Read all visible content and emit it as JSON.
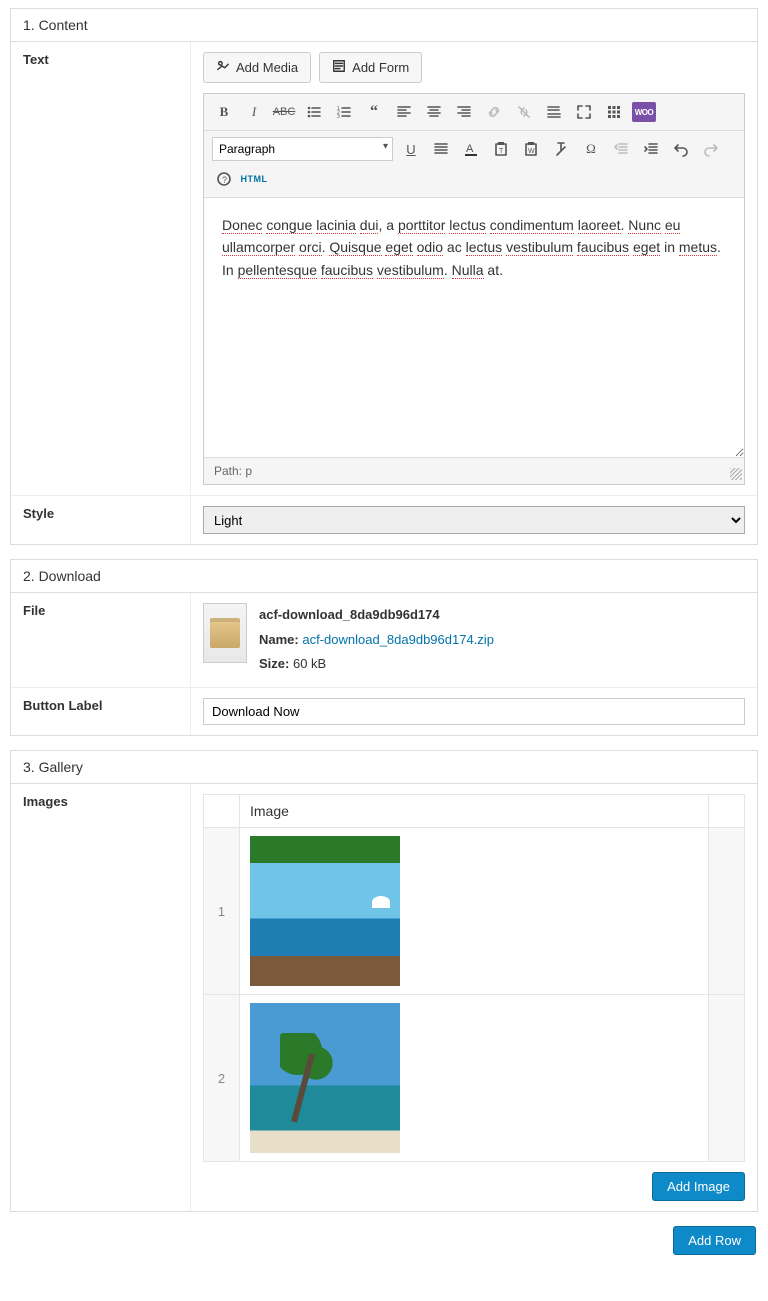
{
  "sections": {
    "content": {
      "title": "1. Content"
    },
    "download": {
      "title": "2. Download"
    },
    "gallery": {
      "title": "3. Gallery"
    }
  },
  "content": {
    "text_label": "Text",
    "add_media": "Add Media",
    "add_form": "Add Form",
    "paragraph_sel": "Paragraph",
    "woo_badge": "WOO",
    "html_badge": "HTML",
    "body_tokens": [
      {
        "t": "Donec",
        "s": 1
      },
      {
        "t": " ",
        "s": 0
      },
      {
        "t": "congue",
        "s": 1
      },
      {
        "t": " ",
        "s": 0
      },
      {
        "t": "lacinia",
        "s": 1
      },
      {
        "t": " ",
        "s": 0
      },
      {
        "t": "dui",
        "s": 1
      },
      {
        "t": ", a ",
        "s": 0
      },
      {
        "t": "porttitor",
        "s": 1
      },
      {
        "t": " ",
        "s": 0
      },
      {
        "t": "lectus",
        "s": 1
      },
      {
        "t": " ",
        "s": 0
      },
      {
        "t": "condimentum",
        "s": 1
      },
      {
        "t": " ",
        "s": 0
      },
      {
        "t": "laoreet",
        "s": 1
      },
      {
        "t": ". ",
        "s": 0
      },
      {
        "t": "Nunc",
        "s": 1
      },
      {
        "t": " ",
        "s": 0
      },
      {
        "t": "eu",
        "s": 1
      },
      {
        "t": " ",
        "s": 0
      },
      {
        "t": "ullamcorper",
        "s": 1
      },
      {
        "t": " ",
        "s": 0
      },
      {
        "t": "orci",
        "s": 1
      },
      {
        "t": ". ",
        "s": 0
      },
      {
        "t": "Quisque",
        "s": 1
      },
      {
        "t": " ",
        "s": 0
      },
      {
        "t": "eget",
        "s": 1
      },
      {
        "t": " ",
        "s": 0
      },
      {
        "t": "odio",
        "s": 1
      },
      {
        "t": " ac ",
        "s": 0
      },
      {
        "t": "lectus",
        "s": 1
      },
      {
        "t": " ",
        "s": 0
      },
      {
        "t": "vestibulum",
        "s": 1
      },
      {
        "t": " ",
        "s": 0
      },
      {
        "t": "faucibus",
        "s": 1
      },
      {
        "t": " ",
        "s": 0
      },
      {
        "t": "eget",
        "s": 1
      },
      {
        "t": " in ",
        "s": 0
      },
      {
        "t": "metus",
        "s": 1
      },
      {
        "t": ". In ",
        "s": 0
      },
      {
        "t": "pellentesque",
        "s": 1
      },
      {
        "t": " ",
        "s": 0
      },
      {
        "t": "faucibus",
        "s": 1
      },
      {
        "t": " ",
        "s": 0
      },
      {
        "t": "vestibulum",
        "s": 1
      },
      {
        "t": ". ",
        "s": 0
      },
      {
        "t": "Nulla",
        "s": 1
      },
      {
        "t": " at.",
        "s": 0
      }
    ],
    "path_label": "Path: p",
    "style_label": "Style",
    "style_value": "Light"
  },
  "download": {
    "file_label": "File",
    "file_title": "acf-download_8da9db96d174",
    "name_label": "Name:",
    "file_name": "acf-download_8da9db96d174.zip",
    "size_label": "Size:",
    "file_size": "60 kB",
    "button_label_label": "Button Label",
    "button_label_value": "Download Now"
  },
  "gallery": {
    "images_label": "Images",
    "col_image": "Image",
    "rows": [
      {
        "n": "1"
      },
      {
        "n": "2"
      }
    ],
    "add_image": "Add Image"
  },
  "add_row": "Add Row"
}
